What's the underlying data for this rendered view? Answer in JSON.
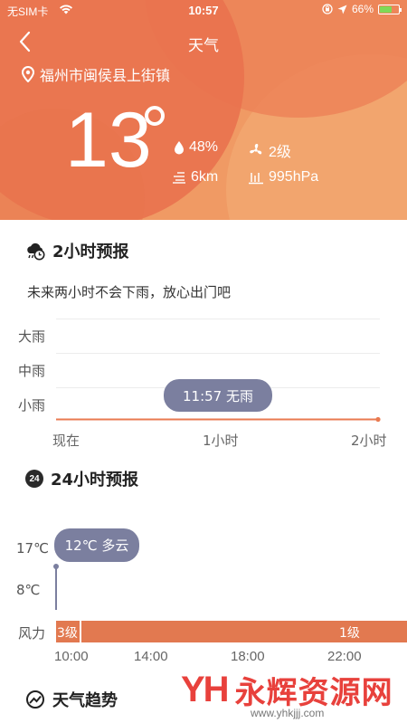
{
  "status_bar": {
    "carrier": "无SIM卡",
    "time": "10:57",
    "battery": "66%",
    "battery_level": 0.66,
    "colors": {
      "battery_fill": "#7ed957"
    }
  },
  "nav": {
    "back_icon": "chevron-left-icon",
    "title": "天气"
  },
  "location": {
    "icon": "location-pin-icon",
    "name": "福州市闽侯县上街镇"
  },
  "current": {
    "temperature": "13",
    "humidity": "48%",
    "wind_level": "2级",
    "visibility": "6km",
    "pressure": "995hPa"
  },
  "forecast_2h": {
    "icon": "rain-cloud-clock-icon",
    "title": "2小时预报",
    "note": "未来两小时不会下雨，放心出门吧",
    "y_labels": [
      "大雨",
      "中雨",
      "小雨"
    ],
    "x_labels": [
      "现在",
      "1小时",
      "2小时"
    ],
    "bubble": "11:57 无雨"
  },
  "forecast_24h": {
    "icon": "24-badge-icon",
    "badge": "24",
    "title": "24小时预报",
    "y_labels": [
      "17℃",
      "8℃"
    ],
    "bubble": "12℃ 多云",
    "wind_label": "风力",
    "wind_values": [
      "3级",
      "1级"
    ],
    "x_labels": [
      "10:00",
      "14:00",
      "18:00",
      "22:00"
    ]
  },
  "trend": {
    "icon": "trend-chart-icon",
    "title": "天气趋势"
  },
  "watermark": {
    "logo_text": "YH",
    "brand": "永辉资源网",
    "url": "www.yhkjjj.com"
  },
  "colors": {
    "accent": "#e97a50",
    "bubble": "#7b7f9f",
    "watermark": "#e8413c"
  }
}
